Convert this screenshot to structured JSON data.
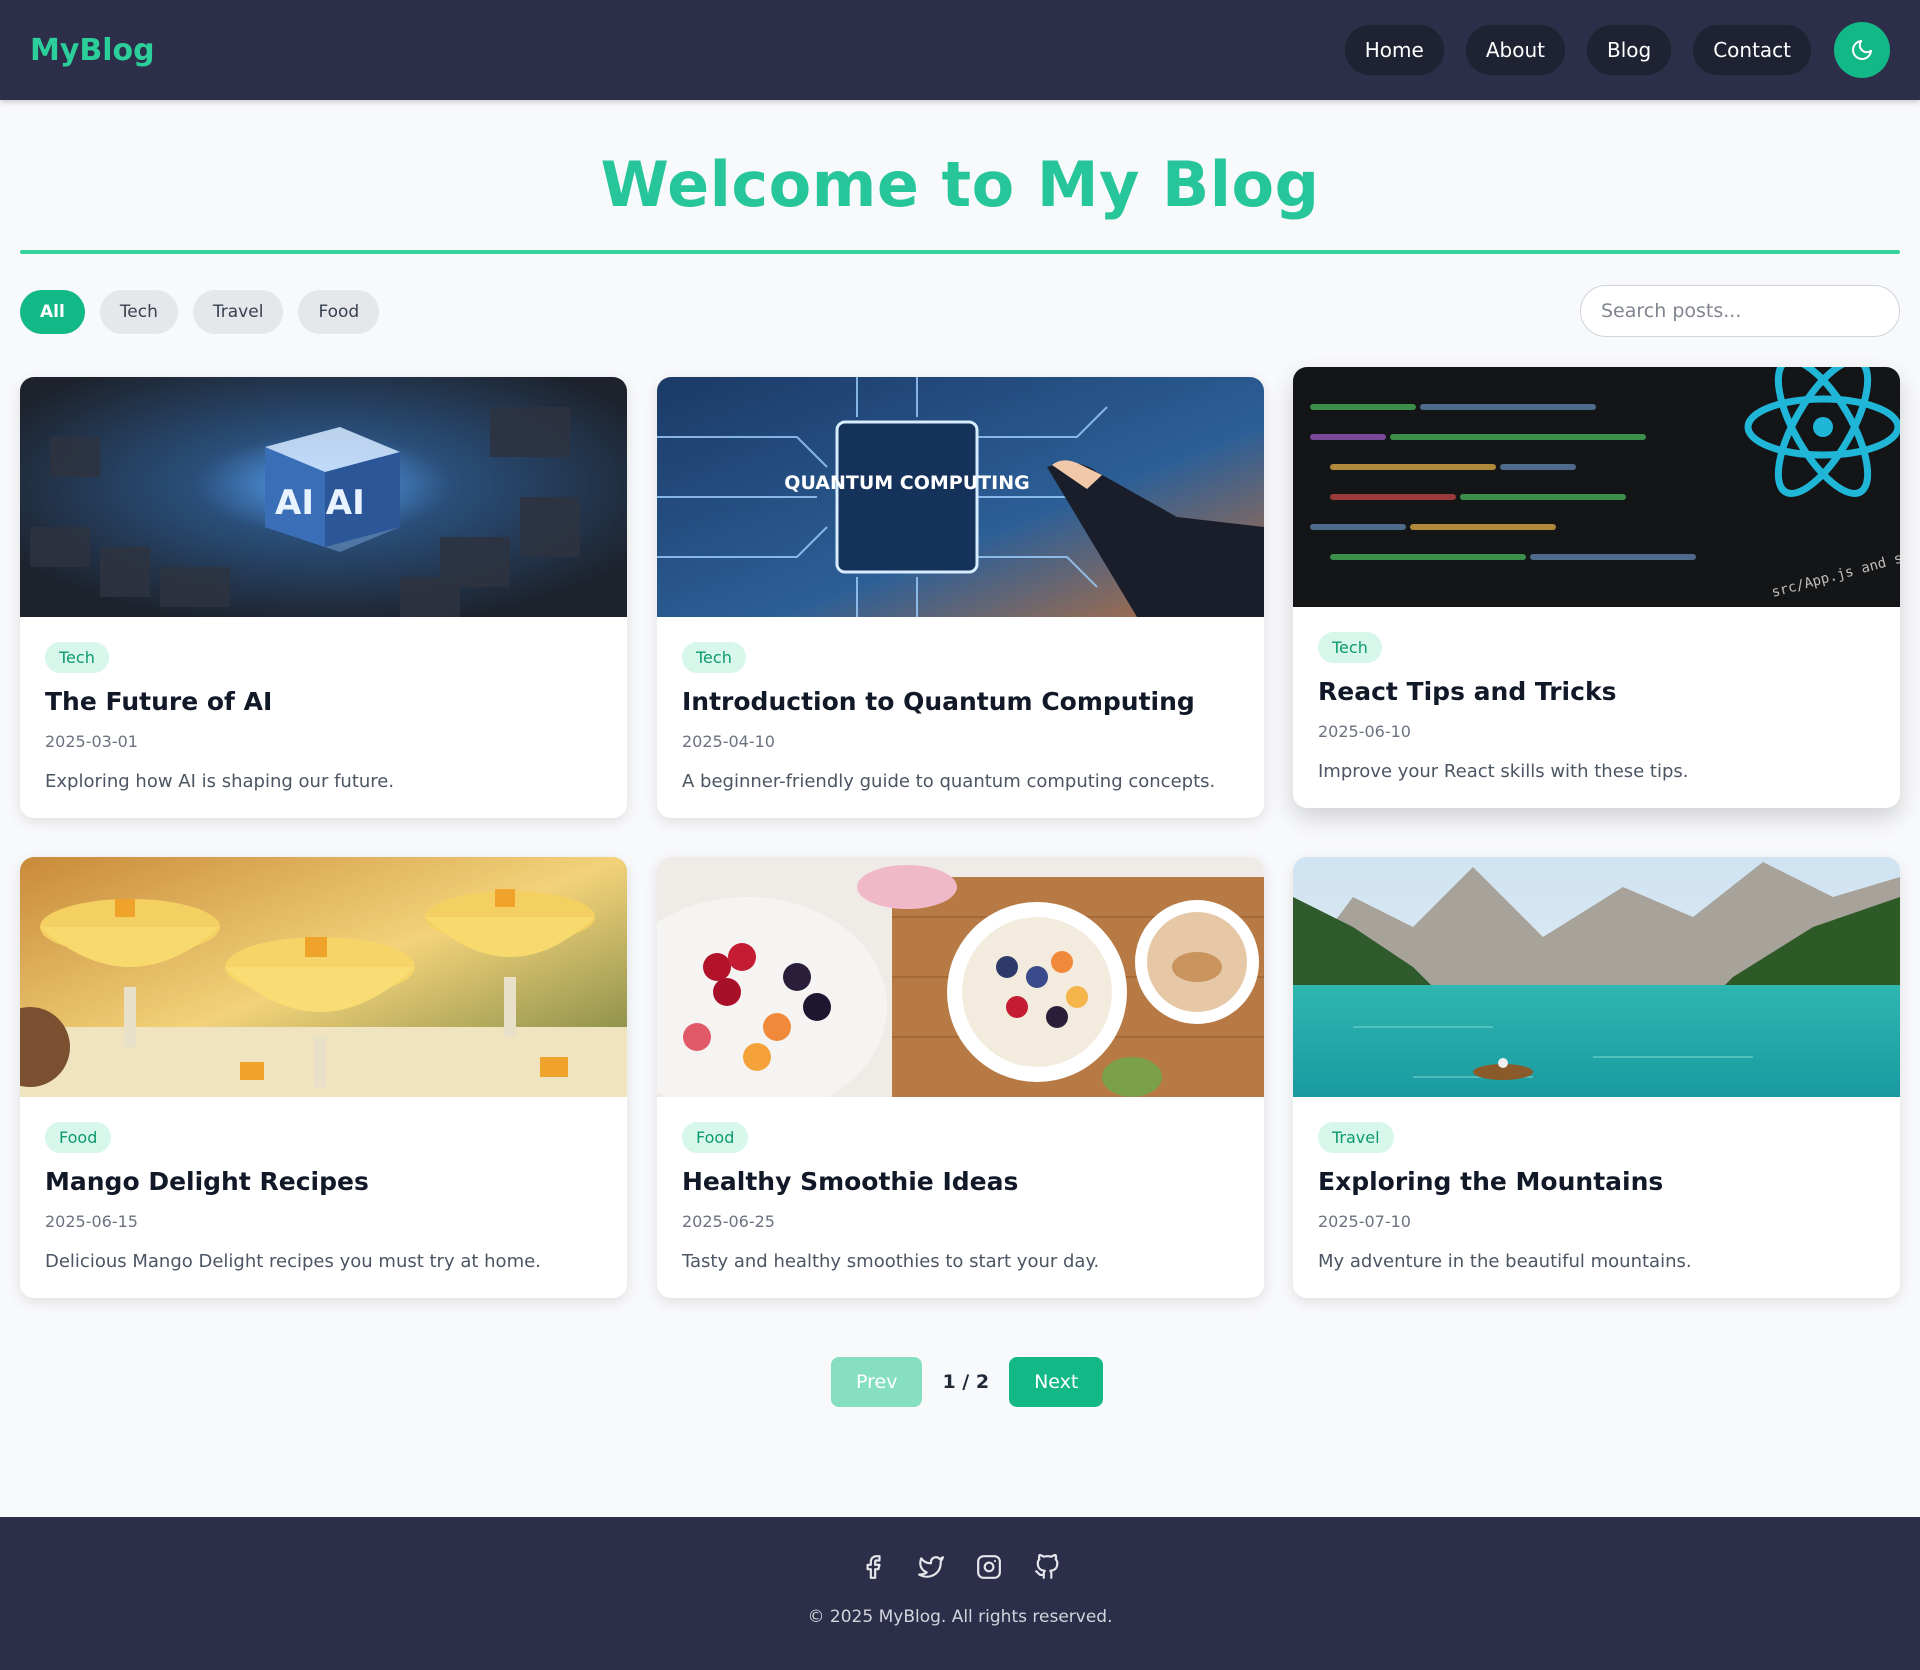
{
  "brand": "MyBlog",
  "nav": {
    "links": [
      "Home",
      "About",
      "Blog",
      "Contact"
    ],
    "theme_icon": "moon-icon"
  },
  "hero": {
    "title": "Welcome to My Blog"
  },
  "filters": {
    "chips": [
      "All",
      "Tech",
      "Travel",
      "Food"
    ],
    "active": "All"
  },
  "search": {
    "placeholder": "Search posts..."
  },
  "posts": [
    {
      "tag": "Tech",
      "title": "The Future of AI",
      "date": "2025-03-01",
      "excerpt": "Exploring how AI is shaping our future.",
      "image_label": "AI AI"
    },
    {
      "tag": "Tech",
      "title": "Introduction to Quantum Computing",
      "date": "2025-04-10",
      "excerpt": "A beginner-friendly guide to quantum computing concepts.",
      "image_label": "QUANTUM COMPUTING"
    },
    {
      "tag": "Tech",
      "title": "React Tips and Tricks",
      "date": "2025-06-10",
      "excerpt": "Improve your React skills with these tips.",
      "image_label": "src/App.js and save to"
    },
    {
      "tag": "Food",
      "title": "Mango Delight Recipes",
      "date": "2025-06-15",
      "excerpt": "Delicious Mango Delight recipes you must try at home.",
      "image_label": ""
    },
    {
      "tag": "Food",
      "title": "Healthy Smoothie Ideas",
      "date": "2025-06-25",
      "excerpt": "Tasty and healthy smoothies to start your day.",
      "image_label": ""
    },
    {
      "tag": "Travel",
      "title": "Exploring the Mountains",
      "date": "2025-07-10",
      "excerpt": "My adventure in the beautiful mountains.",
      "image_label": ""
    }
  ],
  "pagination": {
    "prev": "Prev",
    "next": "Next",
    "indicator": "1 / 2"
  },
  "footer": {
    "socials": [
      "facebook-icon",
      "twitter-icon",
      "instagram-icon",
      "github-icon"
    ],
    "copyright": "© 2025 MyBlog. All rights reserved."
  },
  "colors": {
    "accent": "#12b886",
    "title": "#27c59a",
    "navbar": "#2d2f4a",
    "tag_bg": "#d6f7e9"
  }
}
